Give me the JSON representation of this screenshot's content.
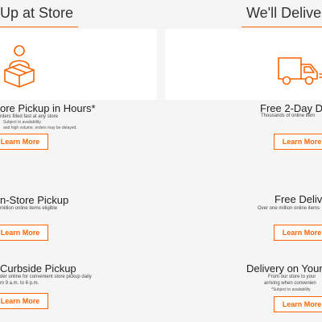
{
  "colors": {
    "accent": "#f96302",
    "background": "#f5f5f5",
    "card": "#ffffff"
  },
  "left": {
    "heading": "Up at Store",
    "store_pickup": {
      "icon": "person-carrying-box-icon",
      "title": "ore Pickup in Hours*",
      "line1": "rders filled fast at any store",
      "line2": "Subject to availability.",
      "line3": "and high volume, orders may be delayed.",
      "button": "Learn More"
    },
    "instore_pickup": {
      "title": "n-Store Pickup",
      "line1": "million online items eligible",
      "button": "Learn More"
    },
    "curbside_pickup": {
      "title": "Curbside Pickup",
      "line1": "der online for convenient store pickup daily",
      "line2": "m 9 a.m. to 6 p.m.",
      "button": "Learn More"
    }
  },
  "right": {
    "heading": "We'll Deliver It",
    "two_day": {
      "icon": "delivery-truck-icon",
      "title": "Free 2-Day De",
      "line1": "Thousands of online item",
      "button": "Learn More"
    },
    "free_delivery": {
      "title": "Free Delive",
      "line1": "Over one million online items",
      "button": "Learn More"
    },
    "schedule": {
      "title": "Delivery on Your S",
      "line1": "From our store to your",
      "line2": "arriving when convenien",
      "line3": "*Subject to availability",
      "button": "Learn More"
    }
  }
}
